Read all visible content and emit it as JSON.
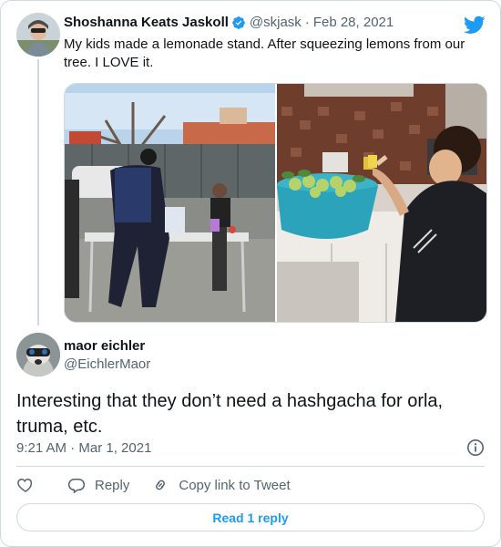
{
  "parent_tweet": {
    "author_name": "Shoshanna Keats Jaskoll",
    "verified_icon": "verified-badge-icon",
    "handle": "@skjask",
    "separator": "·",
    "date": "Feb 28, 2021",
    "text": "My kids made a lemonade stand. After squeezing lemons from our tree. I LOVE it.",
    "media": [
      {
        "icon": "photo-lemonade-stand"
      },
      {
        "icon": "photo-kid-squeezing-lemons"
      }
    ]
  },
  "reply_tweet": {
    "author_name": "maor eichler",
    "handle": "@EichlerMaor",
    "text": "Interesting that they don’t need a hashgacha for orla, truma, etc.",
    "timestamp": "9:21 AM · Mar 1, 2021"
  },
  "actions": {
    "reply_label": "Reply",
    "copy_link_label": "Copy link to Tweet"
  },
  "read_replies_label": "Read 1 reply",
  "colors": {
    "accent": "#1d9bf0",
    "text_primary": "#0f1419",
    "text_secondary": "#536471",
    "border": "#cfd9de"
  }
}
